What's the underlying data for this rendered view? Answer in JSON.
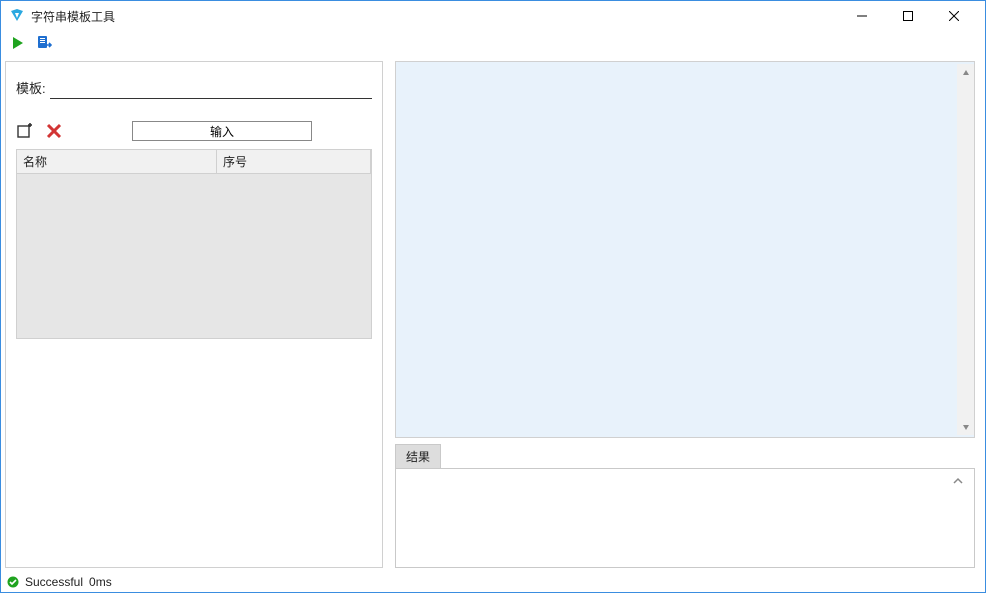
{
  "window": {
    "title": "字符串模板工具"
  },
  "left": {
    "template_label": "模板:",
    "template_value": "",
    "input_button": "输入",
    "columns": {
      "name": "名称",
      "index": "序号"
    }
  },
  "right": {
    "result_tab": "结果"
  },
  "status": {
    "text": "Successful",
    "time": "0ms"
  },
  "colors": {
    "run_green": "#1fa31f",
    "export_blue": "#1f6fd0",
    "delete_red": "#d23535",
    "accent": "#3a8de0"
  }
}
